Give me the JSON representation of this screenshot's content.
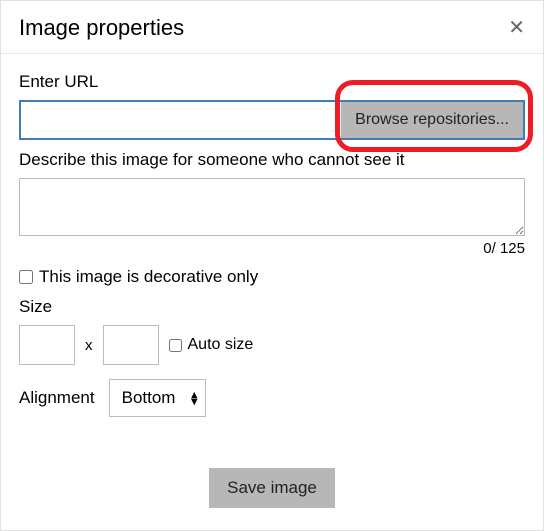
{
  "header": {
    "title": "Image properties"
  },
  "url": {
    "label": "Enter URL",
    "value": "",
    "browse_label": "Browse repositories..."
  },
  "description": {
    "label": "Describe this image for someone who cannot see it",
    "value": "",
    "counter": "0/ 125"
  },
  "decorative": {
    "label": "This image is decorative only",
    "checked": false
  },
  "size": {
    "label": "Size",
    "width": "",
    "height": "",
    "separator": "x",
    "auto_label": "Auto size",
    "auto_checked": false
  },
  "alignment": {
    "label": "Alignment",
    "selected": "Bottom"
  },
  "footer": {
    "save_label": "Save image"
  }
}
